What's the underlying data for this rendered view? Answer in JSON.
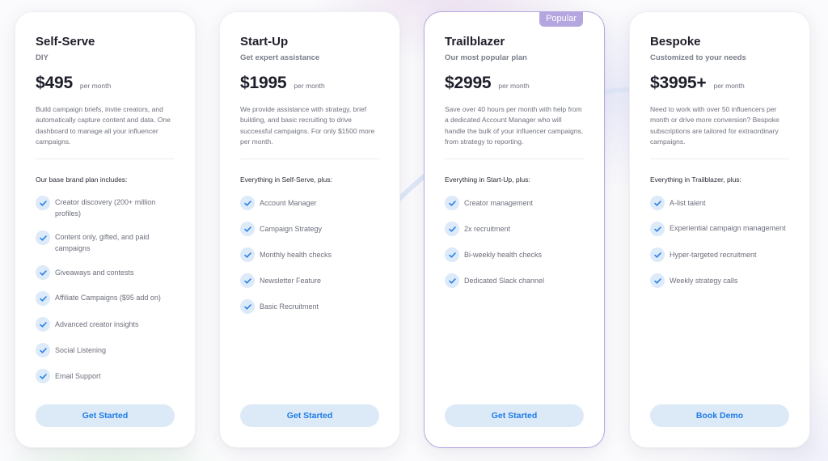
{
  "colors": {
    "accent_blue": "#1f7be6",
    "button_bg": "#dceaf8",
    "popular_border": "#b7a7e2",
    "popular_badge": "#b5a6e0",
    "check_bg": "#dceaf9"
  },
  "plans": [
    {
      "name": "Self-Serve",
      "tagline": "DIY",
      "price": "$495",
      "per": "per month",
      "description": "Build campaign briefs, invite creators, and automatically capture content and data. One dashboard to manage all your influencer campaigns.",
      "intro": "Our base brand plan includes:",
      "features": [
        "Creator discovery (200+ million profiles)",
        "Content only, gifted, and paid campaigns",
        "Giveaways and contests",
        "Affiliate Campaigns ($95 add on)",
        "Advanced creator insights",
        "Social Listening",
        "Email Support"
      ],
      "cta": "Get Started",
      "popular": false
    },
    {
      "name": "Start-Up",
      "tagline": "Get expert assistance",
      "price": "$1995",
      "per": "per month",
      "description": "We provide assistance with strategy, brief building, and basic recruiting to drive successful campaigns. For only $1500 more per month.",
      "intro": "Everything in Self-Serve, plus:",
      "features": [
        "Account Manager",
        "Campaign Strategy",
        "Monthly health checks",
        "Newsletter Feature",
        "Basic Recruitment"
      ],
      "cta": "Get Started",
      "popular": false
    },
    {
      "name": "Trailblazer",
      "tagline": "Our most popular plan",
      "price": "$2995",
      "per": "per month",
      "description": "Save over 40 hours per month with help from a dedicated Account Manager who will handle the bulk of your influencer campaigns, from strategy to reporting.",
      "intro": "Everything in Start-Up, plus:",
      "features": [
        "Creator management",
        "2x recruitment",
        "Bi-weekly health checks",
        "Dedicated Slack channel"
      ],
      "cta": "Get Started",
      "popular": true,
      "badge": "Popular"
    },
    {
      "name": "Bespoke",
      "tagline": "Customized to your needs",
      "price": "$3995+",
      "per": "per month",
      "description": "Need to work with over 50 influencers per month or drive more conversion? Bespoke subscriptions are tailored for extraordinary campaigns.",
      "intro": "Everything in Trailblazer, plus:",
      "features": [
        "A-list talent",
        "Experiential campaign management",
        "Hyper-targeted recruitment",
        "Weekly strategy calls"
      ],
      "cta": "Book Demo",
      "popular": false
    }
  ]
}
